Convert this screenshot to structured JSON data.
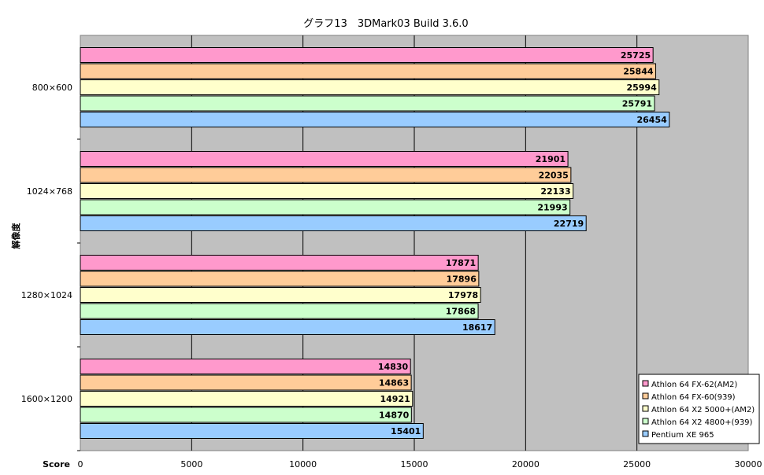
{
  "chart_data": {
    "type": "bar",
    "orientation": "horizontal",
    "title": "グラフ13　3DMark03 Build 3.6.0",
    "ylabel": "解像度",
    "xlabel": "Score",
    "xlim": [
      0,
      30000
    ],
    "xticks": [
      0,
      5000,
      10000,
      15000,
      20000,
      25000,
      30000
    ],
    "grid": true,
    "legend_position": "bottom-right",
    "categories": [
      "800×600",
      "1024×768",
      "1280×1024",
      "1600×1200"
    ],
    "series": [
      {
        "name": "Athlon 64 FX-62(AM2)",
        "color": "#ff99cc",
        "values": [
          25725,
          21901,
          17871,
          14830
        ]
      },
      {
        "name": "Athlon 64 FX-60(939)",
        "color": "#ffcc99",
        "values": [
          25844,
          22035,
          17896,
          14863
        ]
      },
      {
        "name": "Athlon 64 X2 5000+(AM2)",
        "color": "#ffffcc",
        "values": [
          25994,
          22133,
          17978,
          14921
        ]
      },
      {
        "name": "Athlon 64 X2 4800+(939)",
        "color": "#ccffcc",
        "values": [
          25791,
          21993,
          17868,
          14870
        ]
      },
      {
        "name": "Pentium XE 965",
        "color": "#99ccff",
        "values": [
          26454,
          22719,
          18617,
          15401
        ]
      }
    ],
    "plot_background": "#c0c0c0"
  }
}
